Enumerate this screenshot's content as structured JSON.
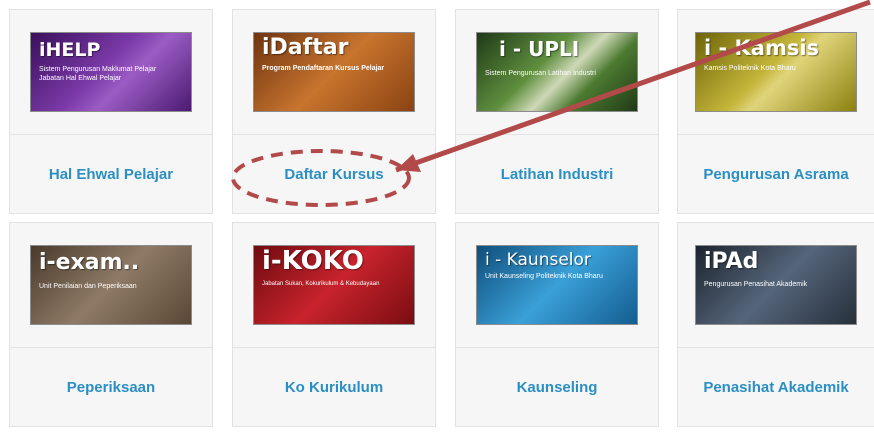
{
  "tiles": [
    {
      "label": "Hal Ehwal Pelajar",
      "logo_title": "iHELP",
      "logo_sub1": "Sistem Pengurusan Maklumat Pelajar",
      "logo_sub2": "Jabatan Hal Ehwal Pelajar"
    },
    {
      "label": "Daftar Kursus",
      "logo_title": "iDaftar",
      "logo_sub1": "Program Pendaftaran Kursus Pelajar",
      "logo_sub2": ""
    },
    {
      "label": "Latihan Industri",
      "logo_title": "i - UPLI",
      "logo_sub1": "Sistem Pengurusan Latihan Industri",
      "logo_sub2": ""
    },
    {
      "label": "Pengurusan Asrama",
      "logo_title": "i - Kamsis",
      "logo_sub1": "Kamsis Politeknik Kota Bharu",
      "logo_sub2": ""
    },
    {
      "label": "Peperiksaan",
      "logo_title": "i-exam..",
      "logo_sub1": "Unit Penilaian dan Peperiksaan",
      "logo_sub2": ""
    },
    {
      "label": "Ko Kurikulum",
      "logo_title": "i-KOKO",
      "logo_sub1": "Jabatan Sukan, Kokurikulum & Kebudayaan",
      "logo_sub2": ""
    },
    {
      "label": "Kaunseling",
      "logo_title": "i - Kaunselor",
      "logo_sub1": "Unit Kaunseling Politeknik Kota Bharu",
      "logo_sub2": ""
    },
    {
      "label": "Penasihat Akademik",
      "logo_title": "iPAd",
      "logo_sub1": "Pengurusan Penasihat Akademik",
      "logo_sub2": ""
    }
  ],
  "colors": {
    "label_text": "#2b8fc4",
    "annotation": "#b24a4a",
    "logo_hal_ehwal": "#6a2c95",
    "logo_daftar": "#b85a1c",
    "logo_latihan": "#3d6e2e",
    "logo_asrama": "#a89a14",
    "logo_peperiksaan": "#7a6552",
    "logo_kokurikulum": "#b01e26",
    "logo_kaunseling": "#1f7fbd",
    "logo_penasihat": "#34404e"
  }
}
